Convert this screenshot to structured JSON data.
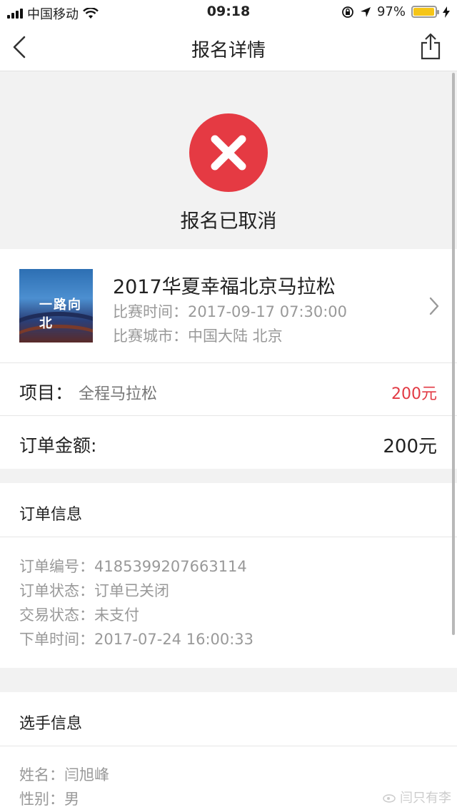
{
  "status_bar": {
    "carrier": "中国移动",
    "time": "09:18",
    "battery": "97%",
    "battery_level": 0.97
  },
  "nav": {
    "title": "报名详情"
  },
  "status": {
    "text": "报名已取消",
    "color": "#e53a43"
  },
  "race": {
    "name": "2017华夏幸福北京马拉松",
    "time_label": "比赛时间：",
    "time_value": "2017-09-17 07:30:00",
    "city_label": "比赛城市：",
    "city_value": "中国大陆 北京",
    "thumb_caption": "一路向北"
  },
  "item": {
    "label": "项目：",
    "value": "全程马拉松",
    "price": "200元",
    "price_color": "#e23a44"
  },
  "amount": {
    "label": "订单金额:",
    "value": "200元"
  },
  "order_info": {
    "title": "订单信息",
    "lines": [
      "订单编号：4185399207663114",
      "订单状态：订单已关闭",
      "交易状态：未支付",
      "下单时间：2017-07-24 16:00:33"
    ]
  },
  "player_info": {
    "title": "选手信息",
    "lines": [
      "姓名：闫旭峰",
      "性别：男"
    ]
  },
  "watermark": "闫只有李"
}
